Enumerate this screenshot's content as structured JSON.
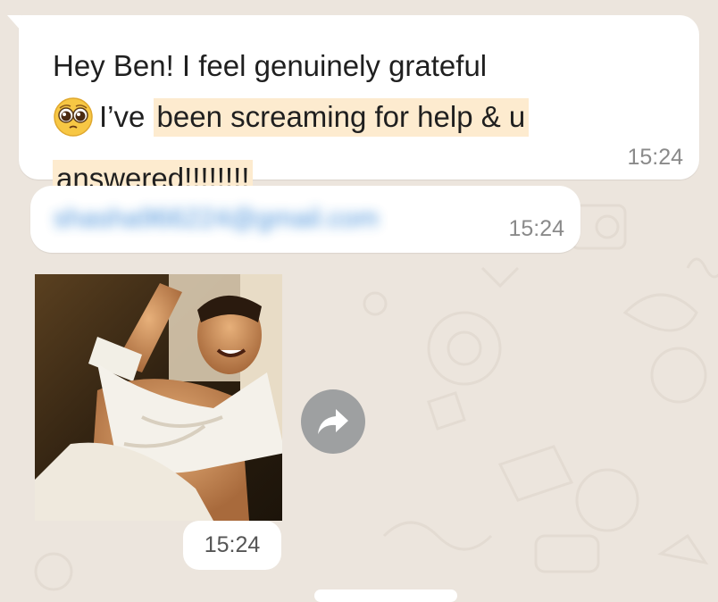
{
  "colors": {
    "background": "#ece5dd",
    "bubble": "#ffffff",
    "highlight": "#fdebcf",
    "timestamp": "#8a8a8a",
    "forward_button": "#9ea0a1"
  },
  "messages": [
    {
      "text_part1": "Hey Ben! I feel genuinely grateful",
      "emoji": "pleading-face-emoji",
      "text_part2": "I’ve ",
      "highlighted": "been screaming for help & u answered!!!!!!!!",
      "time": "15:24"
    },
    {
      "redacted_email": "shasha966224@gmail.com",
      "time": "15:24"
    },
    {
      "media": "image",
      "forward_icon": "forward-arrow-icon",
      "time": "15:24"
    }
  ]
}
